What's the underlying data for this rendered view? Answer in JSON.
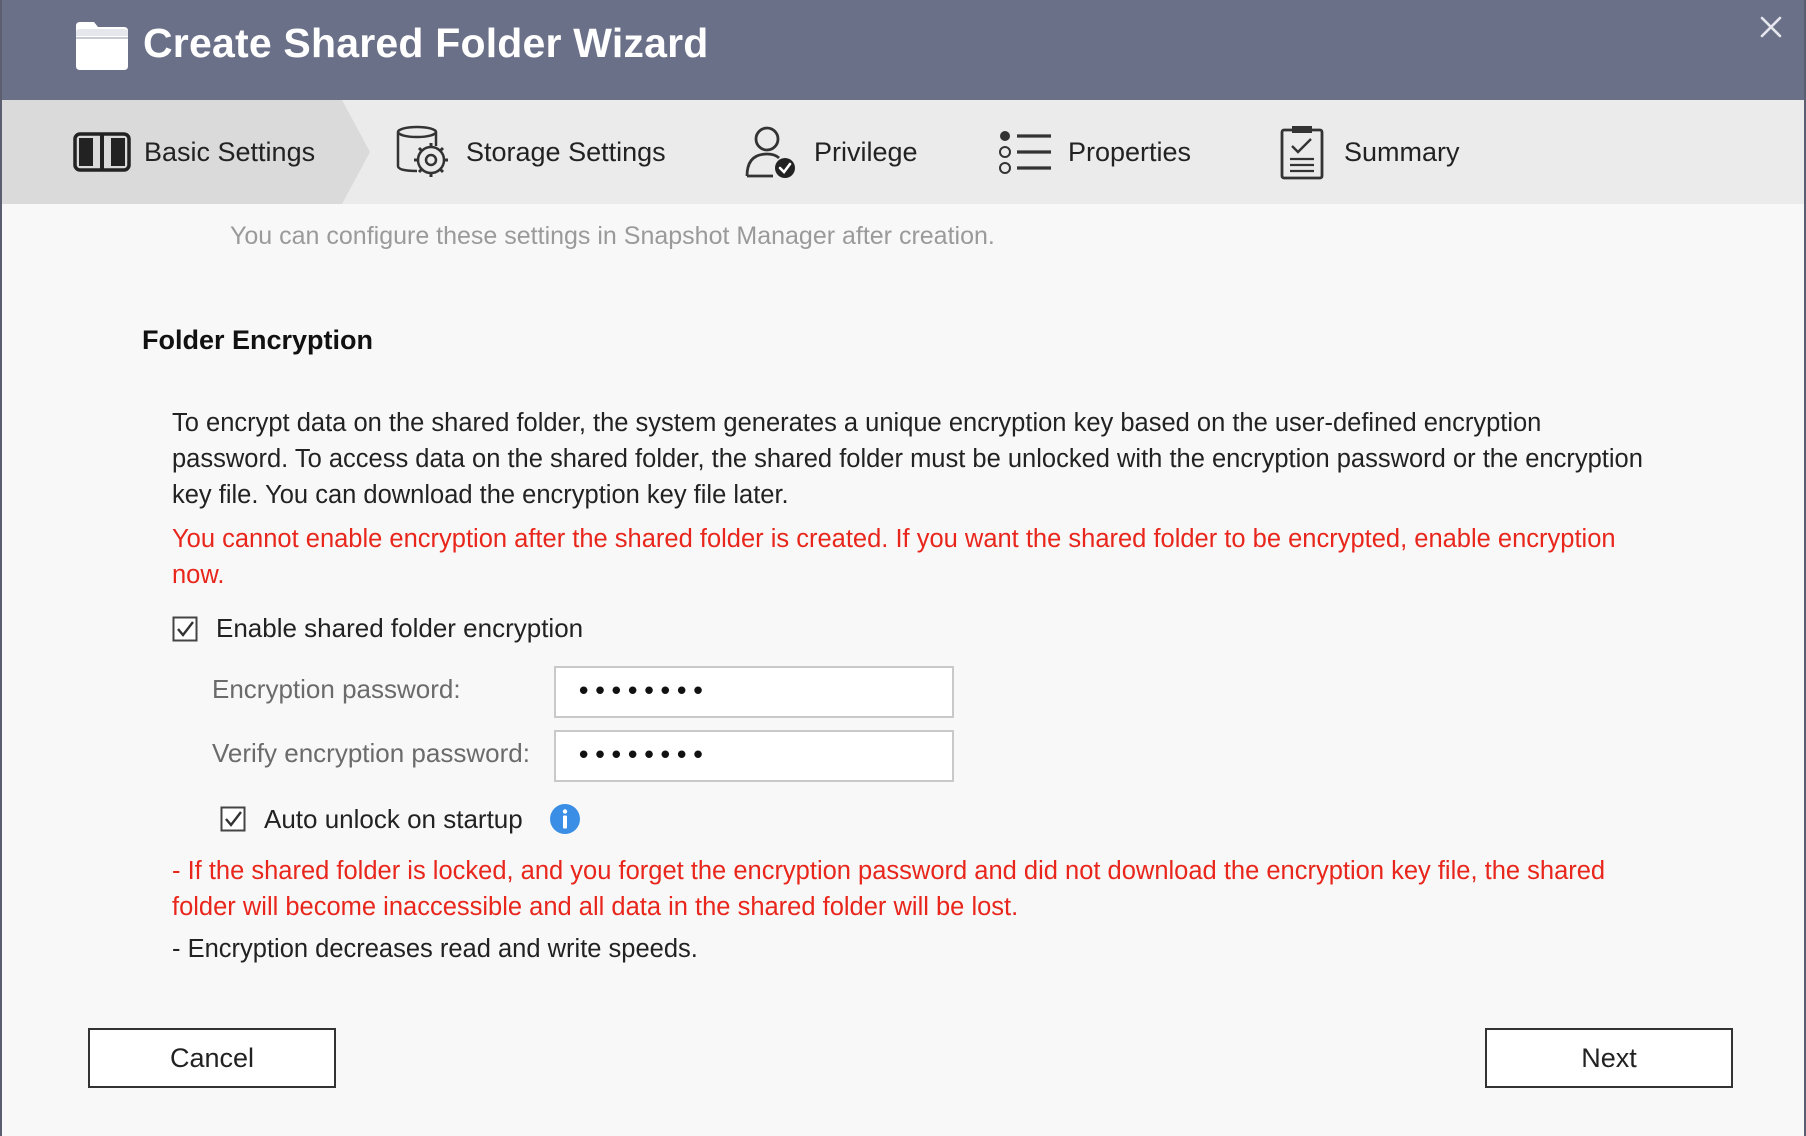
{
  "window": {
    "title": "Create Shared Folder Wizard"
  },
  "steps": [
    {
      "label": "Basic Settings",
      "icon": "book-icon",
      "active": true
    },
    {
      "label": "Storage Settings",
      "icon": "storage-gear-icon",
      "active": false
    },
    {
      "label": "Privilege",
      "icon": "user-check-icon",
      "active": false
    },
    {
      "label": "Properties",
      "icon": "list-icon",
      "active": false
    },
    {
      "label": "Summary",
      "icon": "clipboard-check-icon",
      "active": false
    }
  ],
  "content": {
    "hint": "You can configure these settings in Snapshot Manager after creation.",
    "section_title": "Folder Encryption",
    "description": "To encrypt data on the shared folder, the system generates a unique encryption key based on the user-defined encryption password. To access data on the shared folder, the shared folder must be unlocked with the encryption password or the encryption key file. You can download the encryption key file later.",
    "warning": "You cannot enable encryption after the shared folder is created. If you want the shared folder to be encrypted, enable encryption now.",
    "enable_encryption": {
      "label": "Enable shared folder encryption",
      "checked": true
    },
    "password": {
      "label": "Encryption password:",
      "value": "••••••••"
    },
    "verify_password": {
      "label": "Verify encryption password:",
      "value": "••••••••"
    },
    "auto_unlock": {
      "label": "Auto unlock on startup",
      "checked": true
    },
    "lost_warning": "- If the shared folder is locked, and you forget the encryption password and did not download the encryption key file, the shared folder will become inaccessible and all data in the shared folder will be lost.",
    "speed_note": "- Encryption decreases read and write speeds."
  },
  "footer": {
    "cancel_label": "Cancel",
    "next_label": "Next"
  },
  "colors": {
    "titlebar": "#6b7089",
    "warning": "#e8261c",
    "info": "#3a8ee6"
  }
}
